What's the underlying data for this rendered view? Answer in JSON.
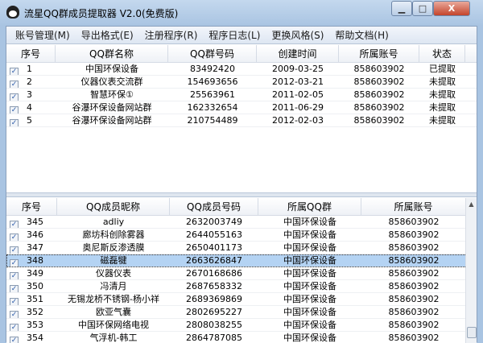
{
  "window": {
    "title": "流星QQ群成员提取器 V2.0(免费版)",
    "min": "▁",
    "max": "□",
    "close": "X"
  },
  "menu": [
    "账号管理(M)",
    "导出格式(E)",
    "注册程序(R)",
    "程序日志(L)",
    "更换风格(S)",
    "帮助文档(H)"
  ],
  "groups": {
    "headers": [
      "序号",
      "QQ群名称",
      "QQ群号码",
      "创建时间",
      "所属账号",
      "状态"
    ],
    "rows": [
      [
        "1",
        "中国环保设备",
        "83492420",
        "2009-03-25",
        "858603902",
        "已提取"
      ],
      [
        "2",
        "仪器仪表交流群",
        "154693656",
        "2012-03-21",
        "858603902",
        "未提取"
      ],
      [
        "3",
        "智慧环保①",
        "25563961",
        "2011-02-05",
        "858603902",
        "未提取"
      ],
      [
        "4",
        "谷瀑环保设备网站群",
        "162332654",
        "2011-06-29",
        "858603902",
        "未提取"
      ],
      [
        "5",
        "谷瀑环保设备网站群",
        "210754489",
        "2012-02-03",
        "858603902",
        "未提取"
      ]
    ]
  },
  "members": {
    "headers": [
      "序号",
      "QQ成员昵称",
      "QQ成员号码",
      "所属QQ群",
      "所属账号"
    ],
    "selected_index": 3,
    "rows": [
      [
        "345",
        "adliy",
        "2632003749",
        "中国环保设备",
        "858603902"
      ],
      [
        "346",
        "廊坊科创除雾器",
        "2644055163",
        "中国环保设备",
        "858603902"
      ],
      [
        "347",
        "奥尼斯反渗透膜",
        "2650401173",
        "中国环保设备",
        "858603902"
      ],
      [
        "348",
        "磁磊犍",
        "2663626847",
        "中国环保设备",
        "858603902"
      ],
      [
        "349",
        "仪器仪表",
        "2670168686",
        "中国环保设备",
        "858603902"
      ],
      [
        "350",
        "冯清月",
        "2687658332",
        "中国环保设备",
        "858603902"
      ],
      [
        "351",
        "无锡龙桥不锈钢-杨小祥",
        "2689369869",
        "中国环保设备",
        "858603902"
      ],
      [
        "352",
        "欧亚气囊",
        "2802695227",
        "中国环保设备",
        "858603902"
      ],
      [
        "353",
        "中国环保网络电视",
        "2808038255",
        "中国环保设备",
        "858603902"
      ],
      [
        "354",
        "气浮机-韩工",
        "2864787085",
        "中国环保设备",
        "858603902"
      ]
    ]
  }
}
